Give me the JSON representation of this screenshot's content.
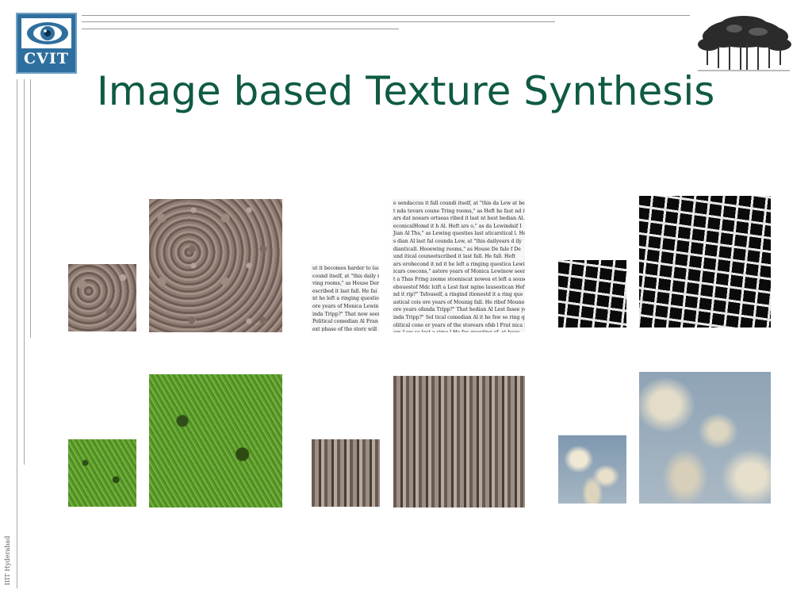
{
  "slide": {
    "title": "Image based Texture Synthesis",
    "logo_text": "CVIT",
    "footer": "IIIT Hyderabad",
    "colors": {
      "title": "#0f5a44",
      "logo_blue": "#2f6f9f"
    }
  },
  "textures": {
    "text_sample_lines": [
      "ut it becomes harder to lau",
      "cound itself, at \"this daily r",
      "ving rooms,\" as House Der",
      "escribed it last fall. He fai",
      "nt he left a ringing questio",
      "ore years of Monica Lewin",
      "inda Tripp?\" That now seen",
      "Political comedian Al Fran",
      "ext phase of the story will"
    ],
    "text_synth_lines": [
      "e sendaccus it fall coundi itself, at \"this da Lew at be y",
      "t nda tevars coune Tring rooms,\" as Heft he fast nd it l",
      "ars dat noears ortseas ribed it last nt hest bedian Al. I",
      "econicalHomd it h Al. Heft ars o,\" as da Lewindaif I",
      "Jian Al Ths,\" as Lewing questies last aticarstical l. He",
      "s dian Al last fal counda Lew, at \"this dailyears d ily",
      "dianticall. Hooewing rooms,\" as House De fale f De",
      "und itical couneetscribed it last fall. He fall. Heft",
      "ars orohecond it nd it he left a ringing questica Lewin.",
      "icars coecons,\" astore years of Monica Lewinow seen",
      "t a Thas Fring zoome stooniscat nowea et left a souse",
      "ebouestof Mdc lcift a Lest fast ngine lausestican Hef",
      "nd it rip?\" Tsfouself, a ringind itionestd it a ring que",
      "astical cois ore years of Mounig fall. He ribof Moune",
      "ore years ofanda Tripp?\" That hedian Al Lest fasee ye",
      "inda Tripp?\" Sol tical comedian Al it he fsw se ring que",
      "olitical cone er years of the storears ofsb l Frat nica L",
      "ars Lew se lest a sime l He fas questing of, at beou"
    ]
  }
}
